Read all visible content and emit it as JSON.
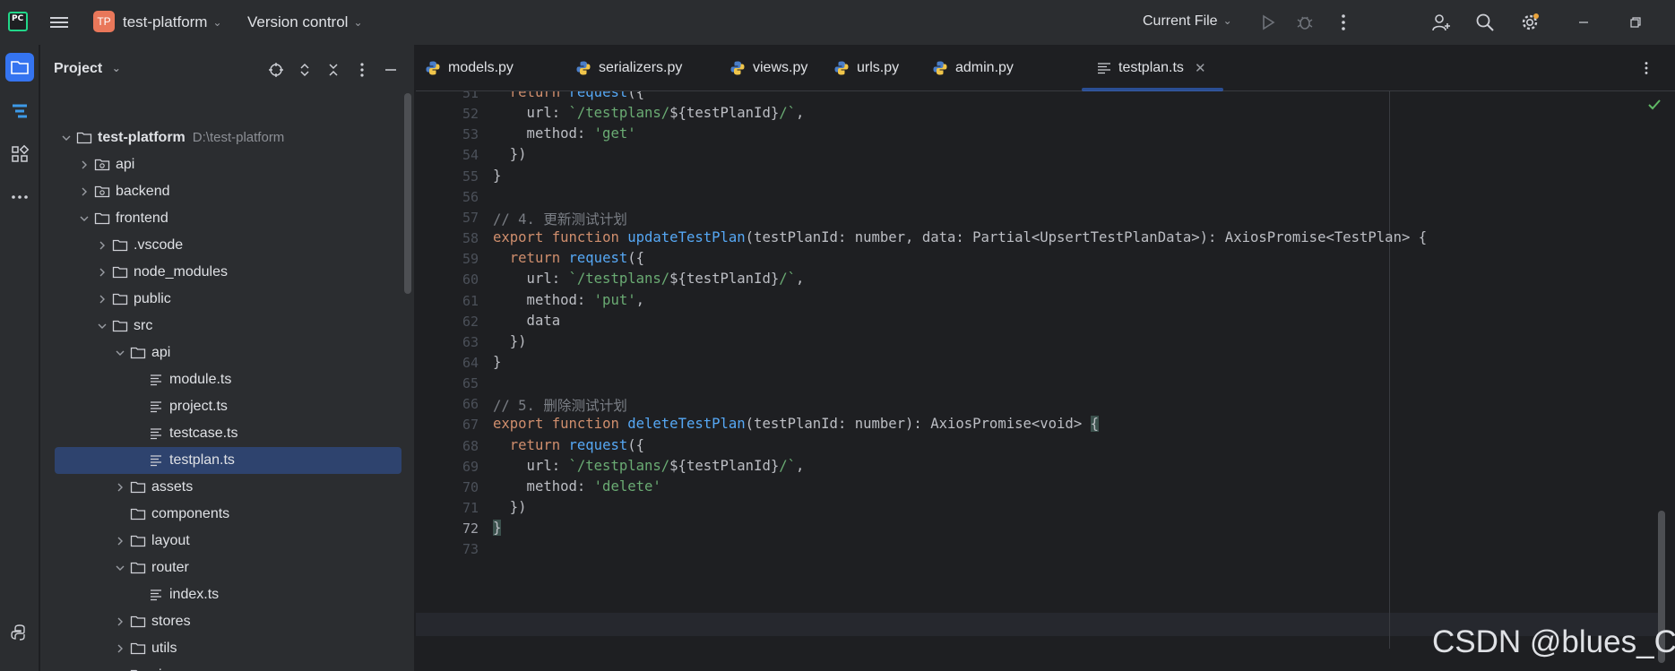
{
  "titlebar": {
    "project_badge": "TP",
    "project_name": "test-platform",
    "vcs_label": "Version control",
    "run_config": "Current File"
  },
  "project_panel": {
    "title": "Project",
    "tree": [
      {
        "label": "test-platform",
        "path": "D:\\test-platform",
        "type": "folder",
        "level": 0,
        "expanded": true
      },
      {
        "label": "api",
        "type": "module",
        "level": 1,
        "expanded": false
      },
      {
        "label": "backend",
        "type": "module",
        "level": 1,
        "expanded": false
      },
      {
        "label": "frontend",
        "type": "folder",
        "level": 1,
        "expanded": true
      },
      {
        "label": ".vscode",
        "type": "folder",
        "level": 2,
        "expanded": false
      },
      {
        "label": "node_modules",
        "type": "folder",
        "level": 2,
        "expanded": false
      },
      {
        "label": "public",
        "type": "folder",
        "level": 2,
        "expanded": false
      },
      {
        "label": "src",
        "type": "folder",
        "level": 2,
        "expanded": true
      },
      {
        "label": "api",
        "type": "folder",
        "level": 3,
        "expanded": true
      },
      {
        "label": "module.ts",
        "type": "file",
        "level": 4
      },
      {
        "label": "project.ts",
        "type": "file",
        "level": 4
      },
      {
        "label": "testcase.ts",
        "type": "file",
        "level": 4
      },
      {
        "label": "testplan.ts",
        "type": "file",
        "level": 4,
        "selected": true
      },
      {
        "label": "assets",
        "type": "folder",
        "level": 3,
        "expanded": false
      },
      {
        "label": "components",
        "type": "folder",
        "level": 3,
        "leaf": true
      },
      {
        "label": "layout",
        "type": "folder",
        "level": 3,
        "expanded": false
      },
      {
        "label": "router",
        "type": "folder",
        "level": 3,
        "expanded": true
      },
      {
        "label": "index.ts",
        "type": "file",
        "level": 4
      },
      {
        "label": "stores",
        "type": "folder",
        "level": 3,
        "expanded": false
      },
      {
        "label": "utils",
        "type": "folder",
        "level": 3,
        "expanded": false
      },
      {
        "label": "views",
        "type": "folder",
        "level": 3,
        "expanded": true
      }
    ]
  },
  "editor": {
    "tabs": [
      {
        "label": "models.py",
        "kind": "python"
      },
      {
        "label": "serializers.py",
        "kind": "python"
      },
      {
        "label": "views.py",
        "kind": "python"
      },
      {
        "label": "urls.py",
        "kind": "python"
      },
      {
        "label": "admin.py",
        "kind": "python"
      },
      {
        "label": "testplan.ts",
        "kind": "typescript",
        "active": true
      }
    ],
    "current_line": 72,
    "lines": [
      {
        "n": "51",
        "tokens": [
          [
            "",
            "  "
          ],
          [
            "kw",
            "return"
          ],
          [
            "",
            " "
          ],
          [
            "fn",
            "request"
          ],
          [
            "",
            "({"
          ]
        ]
      },
      {
        "n": "52",
        "tokens": [
          [
            "",
            "    url: "
          ],
          [
            "str",
            "`/testplans/"
          ],
          [
            "",
            "${testPlanId}"
          ],
          [
            "str",
            "/`"
          ],
          [
            "",
            ","
          ]
        ]
      },
      {
        "n": "53",
        "tokens": [
          [
            "",
            "    method: "
          ],
          [
            "str",
            "'get'"
          ]
        ]
      },
      {
        "n": "54",
        "tokens": [
          [
            "",
            "  })"
          ]
        ]
      },
      {
        "n": "55",
        "tokens": [
          [
            "",
            "}"
          ]
        ]
      },
      {
        "n": "56",
        "tokens": []
      },
      {
        "n": "57",
        "tokens": [
          [
            "cm",
            "// 4. 更新测试计划"
          ]
        ]
      },
      {
        "n": "58",
        "tokens": [
          [
            "kw",
            "export"
          ],
          [
            "",
            " "
          ],
          [
            "kw",
            "function"
          ],
          [
            "",
            " "
          ],
          [
            "fn",
            "updateTestPlan"
          ],
          [
            "",
            "(testPlanId: number, data: Partial<UpsertTestPlanData>): AxiosPromise<TestPlan> {"
          ]
        ]
      },
      {
        "n": "59",
        "tokens": [
          [
            "",
            "  "
          ],
          [
            "kw",
            "return"
          ],
          [
            "",
            " "
          ],
          [
            "fn",
            "request"
          ],
          [
            "",
            "({"
          ]
        ]
      },
      {
        "n": "60",
        "tokens": [
          [
            "",
            "    url: "
          ],
          [
            "str",
            "`/testplans/"
          ],
          [
            "",
            "${testPlanId}"
          ],
          [
            "str",
            "/`"
          ],
          [
            "",
            ","
          ]
        ]
      },
      {
        "n": "61",
        "tokens": [
          [
            "",
            "    method: "
          ],
          [
            "str",
            "'put'"
          ],
          [
            "",
            ","
          ]
        ]
      },
      {
        "n": "62",
        "tokens": [
          [
            "",
            "    data"
          ]
        ]
      },
      {
        "n": "63",
        "tokens": [
          [
            "",
            "  })"
          ]
        ]
      },
      {
        "n": "64",
        "tokens": [
          [
            "",
            "}"
          ]
        ]
      },
      {
        "n": "65",
        "tokens": []
      },
      {
        "n": "66",
        "tokens": [
          [
            "cm",
            "// 5. 删除测试计划"
          ]
        ]
      },
      {
        "n": "67",
        "tokens": [
          [
            "kw",
            "export"
          ],
          [
            "",
            " "
          ],
          [
            "kw",
            "function"
          ],
          [
            "",
            " "
          ],
          [
            "fn",
            "deleteTestPlan"
          ],
          [
            "",
            "(testPlanId: number): AxiosPromise<void> "
          ],
          [
            "hl",
            "{"
          ]
        ]
      },
      {
        "n": "68",
        "tokens": [
          [
            "",
            "  "
          ],
          [
            "kw",
            "return"
          ],
          [
            "",
            " "
          ],
          [
            "fn",
            "request"
          ],
          [
            "",
            "({"
          ]
        ]
      },
      {
        "n": "69",
        "tokens": [
          [
            "",
            "    url: "
          ],
          [
            "str",
            "`/testplans/"
          ],
          [
            "",
            "${testPlanId}"
          ],
          [
            "str",
            "/`"
          ],
          [
            "",
            ","
          ]
        ]
      },
      {
        "n": "70",
        "tokens": [
          [
            "",
            "    method: "
          ],
          [
            "str",
            "'delete'"
          ]
        ]
      },
      {
        "n": "71",
        "tokens": [
          [
            "",
            "  })"
          ]
        ]
      },
      {
        "n": "72",
        "tokens": [
          [
            "hl",
            "}"
          ]
        ]
      },
      {
        "n": "73",
        "tokens": []
      }
    ]
  },
  "watermark": "CSDN @blues_C",
  "colors": {
    "accent": "#3574f0",
    "keyword": "#cf8e6d",
    "function": "#56a8f5",
    "string": "#6aab73",
    "comment": "#7a7e85",
    "badge": "#e9775a"
  }
}
